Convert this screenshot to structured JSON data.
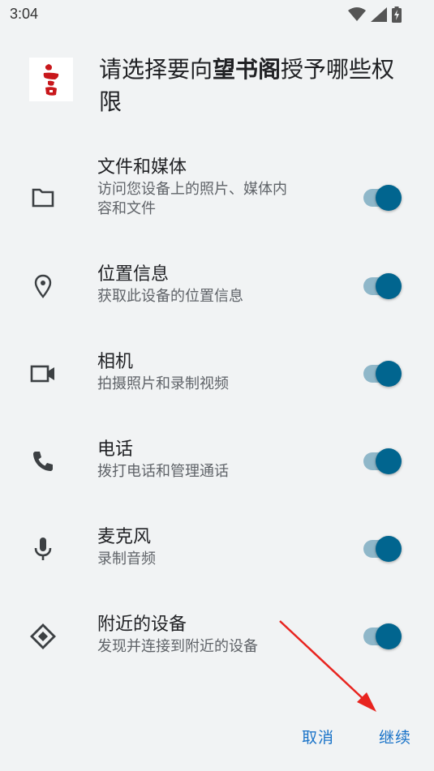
{
  "status_bar": {
    "time": "3:04"
  },
  "header": {
    "prompt_prefix": "请选择要向",
    "app_name": "望书阁",
    "prompt_suffix": "授予哪些权限"
  },
  "permissions": [
    {
      "icon": "folder-icon",
      "title": "文件和媒体",
      "desc_line1": "访问您设备上的照片、媒体内",
      "desc_line2": "容和文件",
      "enabled": true
    },
    {
      "icon": "location-pin-icon",
      "title": "位置信息",
      "desc_line1": "获取此设备的位置信息",
      "enabled": true
    },
    {
      "icon": "video-camera-icon",
      "title": "相机",
      "desc_line1": "拍摄照片和录制视频",
      "enabled": true
    },
    {
      "icon": "phone-icon",
      "title": "电话",
      "desc_line1": "拨打电话和管理通话",
      "enabled": true
    },
    {
      "icon": "microphone-icon",
      "title": "麦克风",
      "desc_line1": "录制音频",
      "enabled": true
    },
    {
      "icon": "nearby-devices-icon",
      "title": "附近的设备",
      "desc_line1": "发现并连接到附近的设备",
      "enabled": true
    }
  ],
  "actions": {
    "cancel_label": "取消",
    "continue_label": "继续"
  },
  "colors": {
    "background": "#f1f3f4",
    "toggle_thumb": "#01658f",
    "toggle_track": "#8fb7c9",
    "action_text": "#1a73c8",
    "annotation_arrow": "#e8241f"
  }
}
